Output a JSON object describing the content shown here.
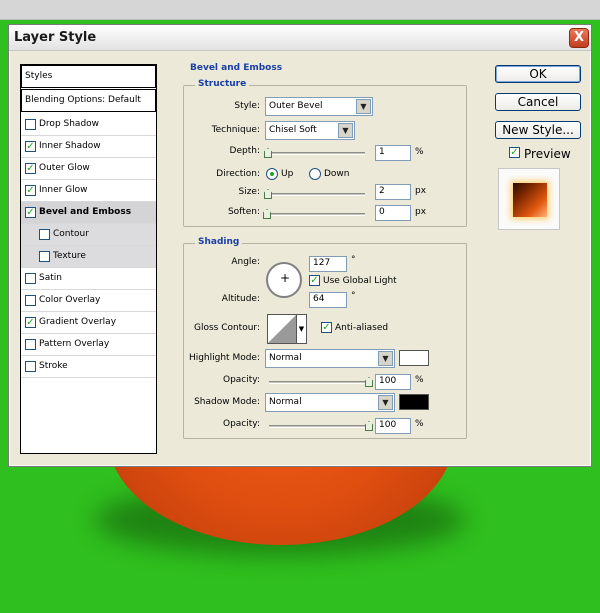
{
  "dialog": {
    "title": "Layer Style",
    "close_label": "X"
  },
  "styles_list": {
    "header": "Styles",
    "blending": "Blending Options: Default",
    "items": [
      {
        "label": "Drop Shadow",
        "checked": false
      },
      {
        "label": "Inner Shadow",
        "checked": true
      },
      {
        "label": "Outer Glow",
        "checked": true
      },
      {
        "label": "Inner Glow",
        "checked": true
      },
      {
        "label": "Bevel and Emboss",
        "checked": true,
        "selected": true
      },
      {
        "label": "Contour",
        "checked": false,
        "sub": true
      },
      {
        "label": "Texture",
        "checked": false,
        "sub": true
      },
      {
        "label": "Satin",
        "checked": false
      },
      {
        "label": "Color Overlay",
        "checked": false
      },
      {
        "label": "Gradient Overlay",
        "checked": true
      },
      {
        "label": "Pattern Overlay",
        "checked": false
      },
      {
        "label": "Stroke",
        "checked": false
      }
    ]
  },
  "bevel": {
    "title": "Bevel and Emboss",
    "structure": {
      "title": "Structure",
      "style_label": "Style:",
      "style_value": "Outer Bevel",
      "technique_label": "Technique:",
      "technique_value": "Chisel Soft",
      "depth_label": "Depth:",
      "depth_value": "1",
      "depth_unit": "%",
      "depth_fraction": 0.01,
      "direction_label": "Direction:",
      "dir_up": "Up",
      "dir_down": "Down",
      "direction_selected": "Up",
      "size_label": "Size:",
      "size_value": "2",
      "size_unit": "px",
      "size_fraction": 0.01,
      "soften_label": "Soften:",
      "soften_value": "0",
      "soften_unit": "px",
      "soften_fraction": 0.0
    },
    "shading": {
      "title": "Shading",
      "angle_label": "Angle:",
      "angle_value": "127",
      "angle_unit": "°",
      "global_light_label": "Use Global Light",
      "global_light_checked": true,
      "altitude_label": "Altitude:",
      "altitude_value": "64",
      "altitude_unit": "°",
      "gloss_label": "Gloss Contour:",
      "antialiased_label": "Anti-aliased",
      "antialiased_checked": true,
      "highlight_mode_label": "Highlight Mode:",
      "highlight_mode_value": "Normal",
      "highlight_color": "#ffffff",
      "highlight_opacity_label": "Opacity:",
      "highlight_opacity_value": "100",
      "highlight_opacity_unit": "%",
      "highlight_opacity_fraction": 1.0,
      "shadow_mode_label": "Shadow Mode:",
      "shadow_mode_value": "Normal",
      "shadow_color": "#000000",
      "shadow_opacity_label": "Opacity:",
      "shadow_opacity_value": "100",
      "shadow_opacity_unit": "%",
      "shadow_opacity_fraction": 1.0
    }
  },
  "buttons": {
    "ok": "OK",
    "cancel": "Cancel",
    "new_style": "New Style...",
    "preview_label": "Preview",
    "preview_checked": true
  }
}
